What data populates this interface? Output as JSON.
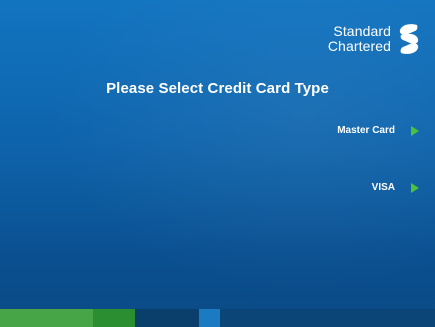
{
  "brand": {
    "line1": "Standard",
    "line2": "Chartered",
    "logo_icon": "standard-chartered-logo-icon"
  },
  "screen": {
    "title": "Please Select Credit Card Type"
  },
  "options": [
    {
      "label": "Master Card",
      "icon": "green-arrow-icon"
    },
    {
      "label": "VISA",
      "icon": "green-arrow-icon"
    }
  ],
  "colors": {
    "background": "#0e63ab",
    "arrow": "#4cc23c",
    "footer": [
      "#47a447",
      "#2b8f32",
      "#0b3f6b",
      "#1a7bc2",
      "#0b4477"
    ]
  }
}
